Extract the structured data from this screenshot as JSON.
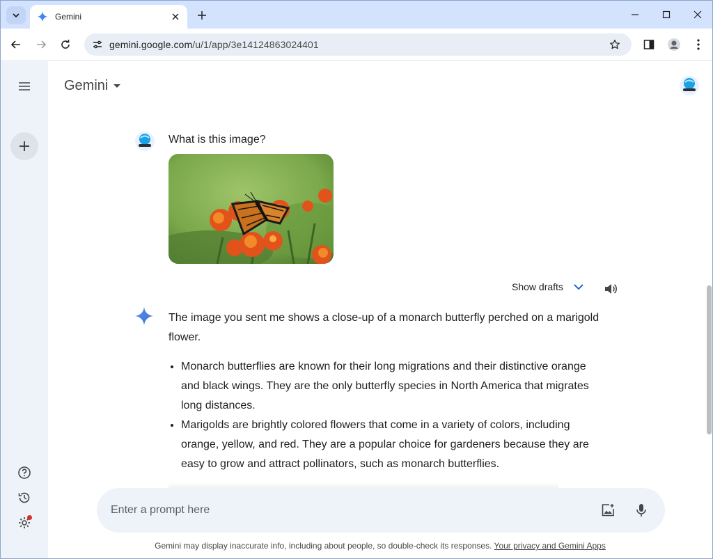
{
  "browser": {
    "tab_title": "Gemini",
    "url_host": "gemini.google.com",
    "url_path": "/u/1/app/3e14124863024401"
  },
  "app": {
    "title": "Gemini"
  },
  "conversation": {
    "user_prompt": "What is this image?",
    "show_drafts_label": "Show drafts",
    "response_intro": "The image you sent me shows a close-up of a monarch butterfly perched on a marigold flower.",
    "bullets": [
      "Monarch butterflies are known for their long migrations and their distinctive orange and black wings. They are the only butterfly species in North America that migrates long distances.",
      "Marigolds are brightly colored flowers that come in a variety of colors, including orange, yellow, and red. They are a popular choice for gardeners because they are easy to grow and attract pollinators, such as monarch butterflies."
    ]
  },
  "input": {
    "placeholder": "Enter a prompt here"
  },
  "footer": {
    "disclaimer": "Gemini may display inaccurate info, including about people, so double-check its responses.",
    "privacy_link": "Your privacy and Gemini Apps"
  },
  "colors": {
    "tabstrip": "#d3e3fd",
    "sidebar": "#eef2f9",
    "gemini_blue": "#4285f4",
    "notification": "#d93025"
  },
  "icons": [
    "tab-search-icon",
    "gemini-sparkle-icon",
    "close-icon",
    "plus-icon",
    "minimize-icon",
    "maximize-icon",
    "back-arrow-icon",
    "forward-arrow-icon",
    "reload-icon",
    "site-info-icon",
    "star-icon",
    "side-panel-icon",
    "profile-icon",
    "kebab-menu-icon",
    "hamburger-menu-icon",
    "help-icon",
    "history-icon",
    "settings-icon",
    "chevron-down-icon",
    "speaker-icon",
    "add-image-icon",
    "microphone-icon"
  ]
}
